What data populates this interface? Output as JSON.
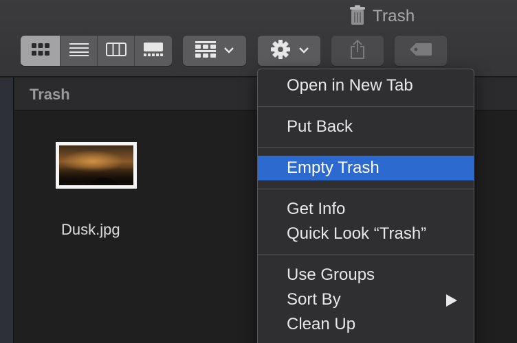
{
  "window": {
    "title": "Trash",
    "trash_icon": "trash-can-icon"
  },
  "toolbar": {
    "view_modes": [
      {
        "name": "icon-view",
        "icon": "grid-icon",
        "active": true
      },
      {
        "name": "list-view",
        "icon": "list-icon",
        "active": false
      },
      {
        "name": "column-view",
        "icon": "columns-icon",
        "active": false
      },
      {
        "name": "gallery-view",
        "icon": "gallery-icon",
        "active": false
      }
    ],
    "group_button_icon": "group-grid-icon",
    "action_button_icon": "gear-icon",
    "share_button_icon": "share-icon",
    "tag_button_icon": "tag-icon"
  },
  "path": {
    "title": "Trash"
  },
  "files": [
    {
      "name": "Dusk.jpg"
    }
  ],
  "context_menu": {
    "items": [
      {
        "label": "Open in New Tab"
      },
      {
        "label": "Put Back"
      },
      {
        "label": "Empty Trash",
        "highlighted": true
      },
      {
        "label": "Get Info"
      },
      {
        "label": "Quick Look “Trash”"
      },
      {
        "label": "Use Groups"
      },
      {
        "label": "Sort By",
        "submenu": true
      },
      {
        "label": "Clean Up"
      }
    ]
  },
  "colors": {
    "highlight": "#2c6ad0",
    "toolbar_button": "#5b5b5e",
    "active_segment": "#a3a3a5"
  }
}
